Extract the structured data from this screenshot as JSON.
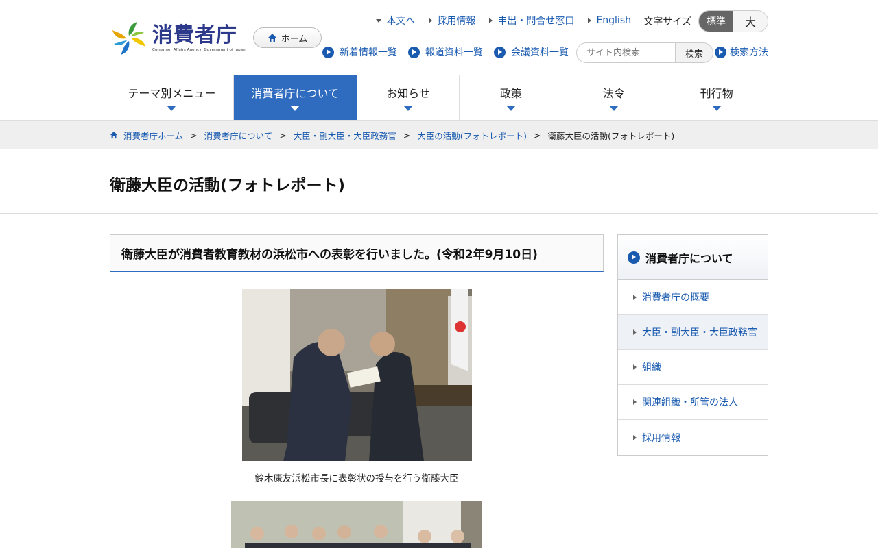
{
  "logo": {
    "title": "消費者庁",
    "subtitle": "Consumer Affairs Agency, Government of Japan"
  },
  "header": {
    "home_label": "ホーム",
    "top_links": [
      "本文へ",
      "採用情報",
      "申出・問合せ窓口",
      "English"
    ],
    "fontsize_label": "文字サイズ",
    "fontsize_standard": "標準",
    "fontsize_large": "大",
    "sub_links": [
      "新着情報一覧",
      "報道資料一覧",
      "会議資料一覧"
    ],
    "search_placeholder": "サイト内検索",
    "search_button": "検索",
    "search_help": "検索方法"
  },
  "gnav": {
    "items": [
      "テーマ別メニュー",
      "消費者庁について",
      "お知らせ",
      "政策",
      "法令",
      "刊行物"
    ],
    "active_index": 1
  },
  "breadcrumb": {
    "items": [
      "消費者庁ホーム",
      "消費者庁について",
      "大臣・副大臣・大臣政務官",
      "大臣の活動(フォトレポート)"
    ],
    "current": "衛藤大臣の活動(フォトレポート)"
  },
  "page": {
    "title": "衛藤大臣の活動(フォトレポート)"
  },
  "article": {
    "heading": "衛藤大臣が消費者教育教材の浜松市への表彰を行いました。(令和2年9月10日)",
    "caption1": "鈴木康友浜松市長に表彰状の授与を行う衛藤大臣"
  },
  "side": {
    "title": "消費者庁について",
    "items": [
      "消費者庁の概要",
      "大臣・副大臣・大臣政務官",
      "組織",
      "関連組織・所管の法人",
      "採用情報"
    ],
    "current_index": 1
  },
  "colors": {
    "accent": "#2f6bbf",
    "link": "#1a5bb0"
  }
}
